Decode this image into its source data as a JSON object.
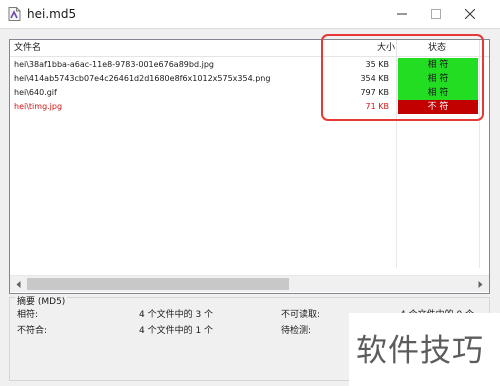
{
  "window": {
    "title": "hei.md5",
    "icon": "md5-document-icon"
  },
  "list": {
    "columns": {
      "name": "文件名",
      "size": "大小",
      "status": "状态"
    },
    "rows": [
      {
        "name": "hei\\38af1bba-a6ac-11e8-9783-001e676a89bd.jpg",
        "size": "35 KB",
        "status": "相 符",
        "state": "match"
      },
      {
        "name": "hei\\414ab5743cb07e4c26461d2d1680e8f6x1012x575x354.png",
        "size": "354 KB",
        "status": "相 符",
        "state": "match"
      },
      {
        "name": "hei\\640.gif",
        "size": "797 KB",
        "status": "相 符",
        "state": "match"
      },
      {
        "name": "hei\\timg.jpg",
        "size": "71 KB",
        "status": "不 符",
        "state": "mismatch"
      }
    ]
  },
  "summary": {
    "title": "摘要 (MD5)",
    "match_label": "相符:",
    "match_value": "4 个文件中的 3 个",
    "mismatch_label": "不符合:",
    "mismatch_value": "4 个文件中的 1 个",
    "unreadable_label": "不可读取:",
    "unreadable_value": "4 个文件中的 0 个",
    "pending_label": "待检测:",
    "pending_value": ""
  },
  "watermark": "软件技巧",
  "colors": {
    "match": "#22dd22",
    "mismatch": "#c20000",
    "mismatch_text": "#d01515",
    "highlight": "#e53935"
  }
}
